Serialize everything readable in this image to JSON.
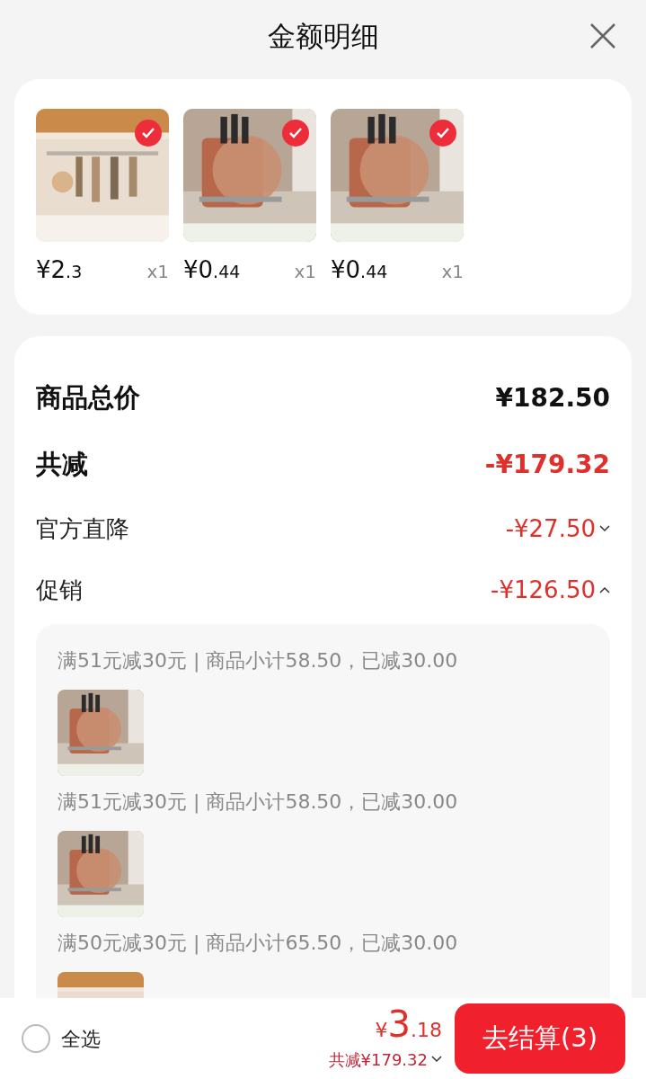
{
  "header": {
    "title": "金额明细"
  },
  "products": [
    {
      "price_main": "¥2",
      "price_decimal": ".3",
      "quantity": "x1",
      "selected": true
    },
    {
      "price_main": "¥0",
      "price_decimal": ".44",
      "quantity": "x1",
      "selected": true
    },
    {
      "price_main": "¥0",
      "price_decimal": ".44",
      "quantity": "x1",
      "selected": true
    }
  ],
  "summary": [
    {
      "kind": "total",
      "label": "商品总价",
      "amount": "¥182.50"
    },
    {
      "kind": "discount_total",
      "label": "共减",
      "amount": "-¥179.32"
    },
    {
      "kind": "discount",
      "label": "官方直降",
      "amount": "-¥27.50",
      "expanded": false
    },
    {
      "kind": "discount",
      "label": "促销",
      "amount": "-¥126.50",
      "expanded": true
    }
  ],
  "promotions": [
    {
      "text": "满51元减30元 | 商品小计58.50，已减30.00"
    },
    {
      "text": "满51元减30元 | 商品小计58.50，已减30.00"
    },
    {
      "text": "满50元减30元 | 商品小计65.50，已减30.00"
    }
  ],
  "footer": {
    "select_all": {
      "label": "全选",
      "checked": false
    },
    "currency": "¥",
    "total_main": "3",
    "total_decimal": ".18",
    "saved": "共减¥179.32",
    "checkout": "去结算(3)"
  }
}
